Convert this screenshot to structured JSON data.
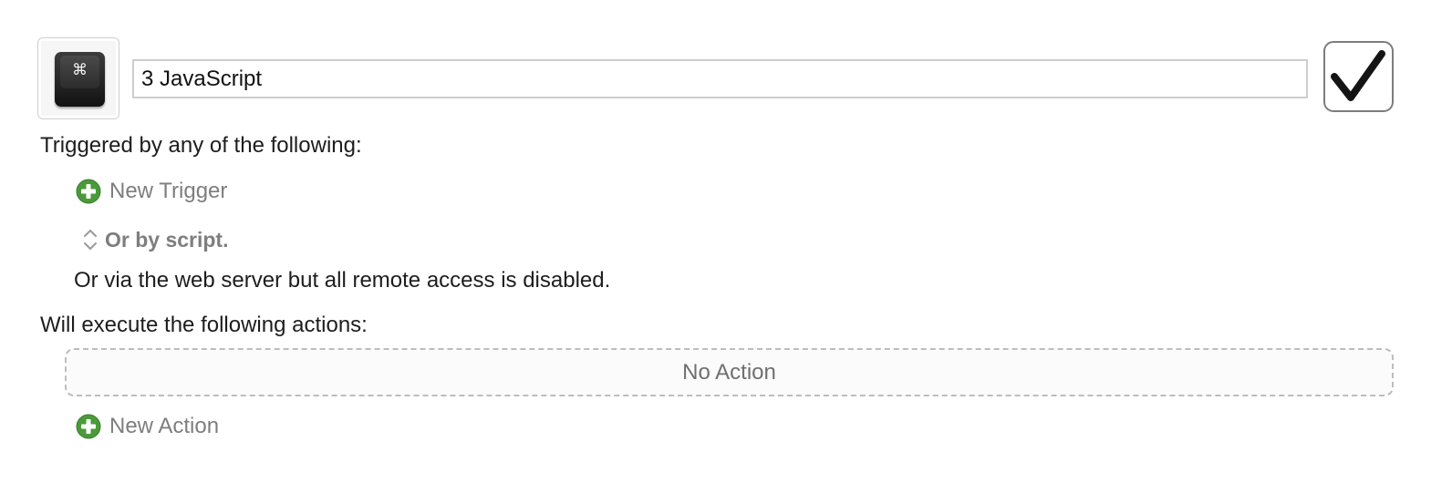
{
  "macro": {
    "name": "3 JavaScript",
    "enabled": true,
    "icon": {
      "name": "command-key-icon",
      "glyph": "⌘"
    }
  },
  "triggers": {
    "heading": "Triggered by any of the following:",
    "new_trigger_label": "New Trigger",
    "or_by_script_label": "Or by script.",
    "web_server_note": "Or via the web server but all remote access is disabled."
  },
  "actions": {
    "heading": "Will execute the following actions:",
    "empty_label": "No Action",
    "new_action_label": "New Action"
  },
  "icons": {
    "add": "plus-circle-icon",
    "disclosure": "up-down-chevron-icon",
    "checkmark": "checkmark-icon"
  },
  "colors": {
    "add_icon_green": "#4a9a3a",
    "muted_text": "#7e7e7e"
  }
}
